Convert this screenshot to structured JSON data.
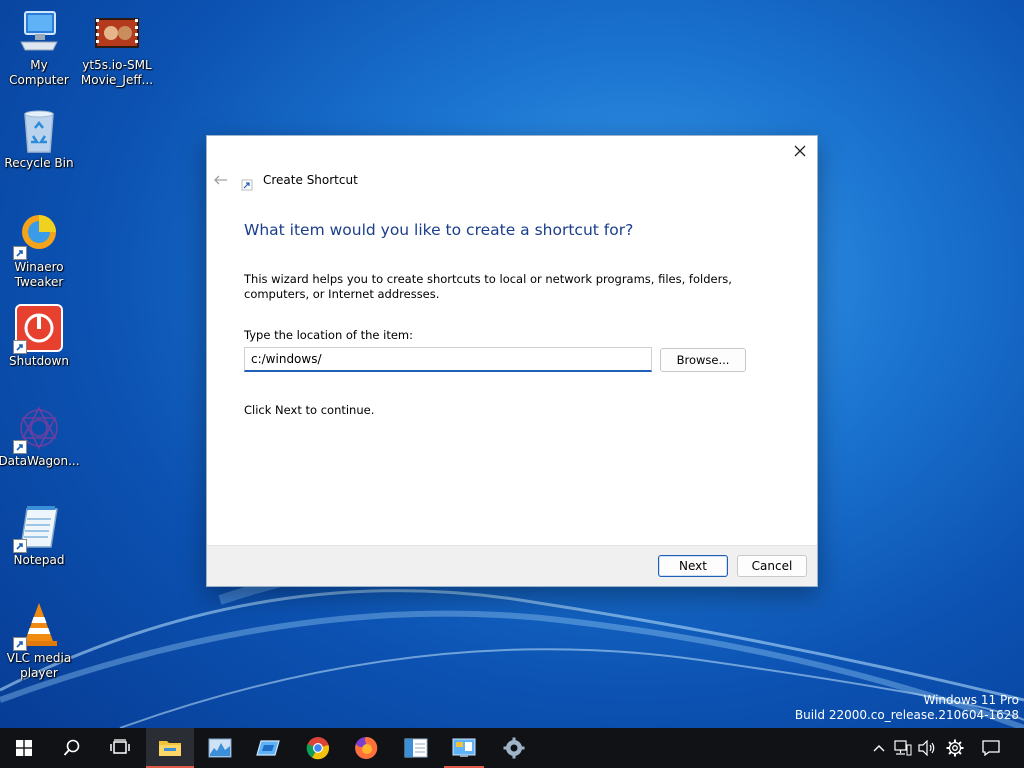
{
  "desktop": {
    "icons": [
      {
        "name": "My Computer"
      },
      {
        "name": "yt5s.io-SML Movie_Jeff..."
      },
      {
        "name": "Recycle Bin"
      },
      {
        "name": "Winaero Tweaker"
      },
      {
        "name": "Shutdown"
      },
      {
        "name": "DataWagon..."
      },
      {
        "name": "Notepad"
      },
      {
        "name": "VLC media player"
      }
    ]
  },
  "dialog": {
    "title": "Create Shortcut",
    "heading": "What item would you like to create a shortcut for?",
    "description": "This wizard helps you to create shortcuts to local or network programs, files, folders, computers, or Internet addresses.",
    "location_label": "Type the location of the item:",
    "location_value": "c:/windows/",
    "browse_label": "Browse...",
    "continue_text": "Click Next to continue.",
    "next_label": "Next",
    "cancel_label": "Cancel"
  },
  "watermark": {
    "line1": "Windows 11 Pro",
    "line2": "Build 22000.co_release.210604-1628"
  },
  "taskbar": {
    "items": [
      "start",
      "search",
      "task-view",
      "file-explorer",
      "resource-monitor",
      "remote-desktop",
      "chrome",
      "firefox",
      "reader",
      "control-panel",
      "settings"
    ],
    "active_item": "file-explorer",
    "accent_color": "#e05a4a"
  },
  "colors": {
    "heading": "#1a3e8c",
    "accent": "#1f5fb7"
  }
}
